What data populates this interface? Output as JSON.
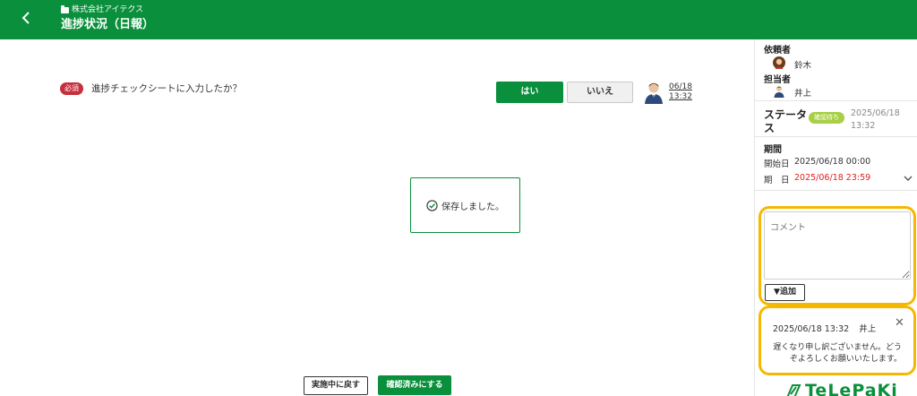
{
  "header": {
    "company": "株式会社アイテクス",
    "title": "進捗状況（日報）"
  },
  "question": {
    "required_label": "必須",
    "text": "進捗チェックシートに入力したか？",
    "yes_label": "はい",
    "no_label": "いいえ",
    "answer_date": "06/18",
    "answer_time": "13:32"
  },
  "toast": {
    "message": "保存しました。"
  },
  "actions": {
    "back_label": "実施中に戻す",
    "confirm_label": "確認済みにする"
  },
  "sidebar": {
    "requester_label": "依頼者",
    "requester_name": "鈴木",
    "assignee_label": "担当者",
    "assignee_name": "井上",
    "status_label_1": "ステータ",
    "status_label_2": "ス",
    "status_badge": "確認待ち",
    "status_date": "2025/06/18",
    "status_time": "13:32",
    "period_label": "期間",
    "start_label": "開始日",
    "start_value": "2025/06/18 00:00",
    "due_label": "期　日",
    "due_value": "2025/06/18 23:59",
    "comment_placeholder": "コメント",
    "add_label": "▼追加",
    "history_time": "2025/06/18 13:32",
    "history_user": "井上",
    "history_message": "遅くなり申し訳ございません。どうぞよろしくお願いいたします。",
    "logo_text": "TeLePaKi"
  },
  "colors": {
    "brand_green": "#0a8f3c",
    "required_red": "#c62f3d",
    "due_red": "#e02020",
    "status_green": "#a8cf45",
    "highlight_yellow": "#f5b800"
  }
}
